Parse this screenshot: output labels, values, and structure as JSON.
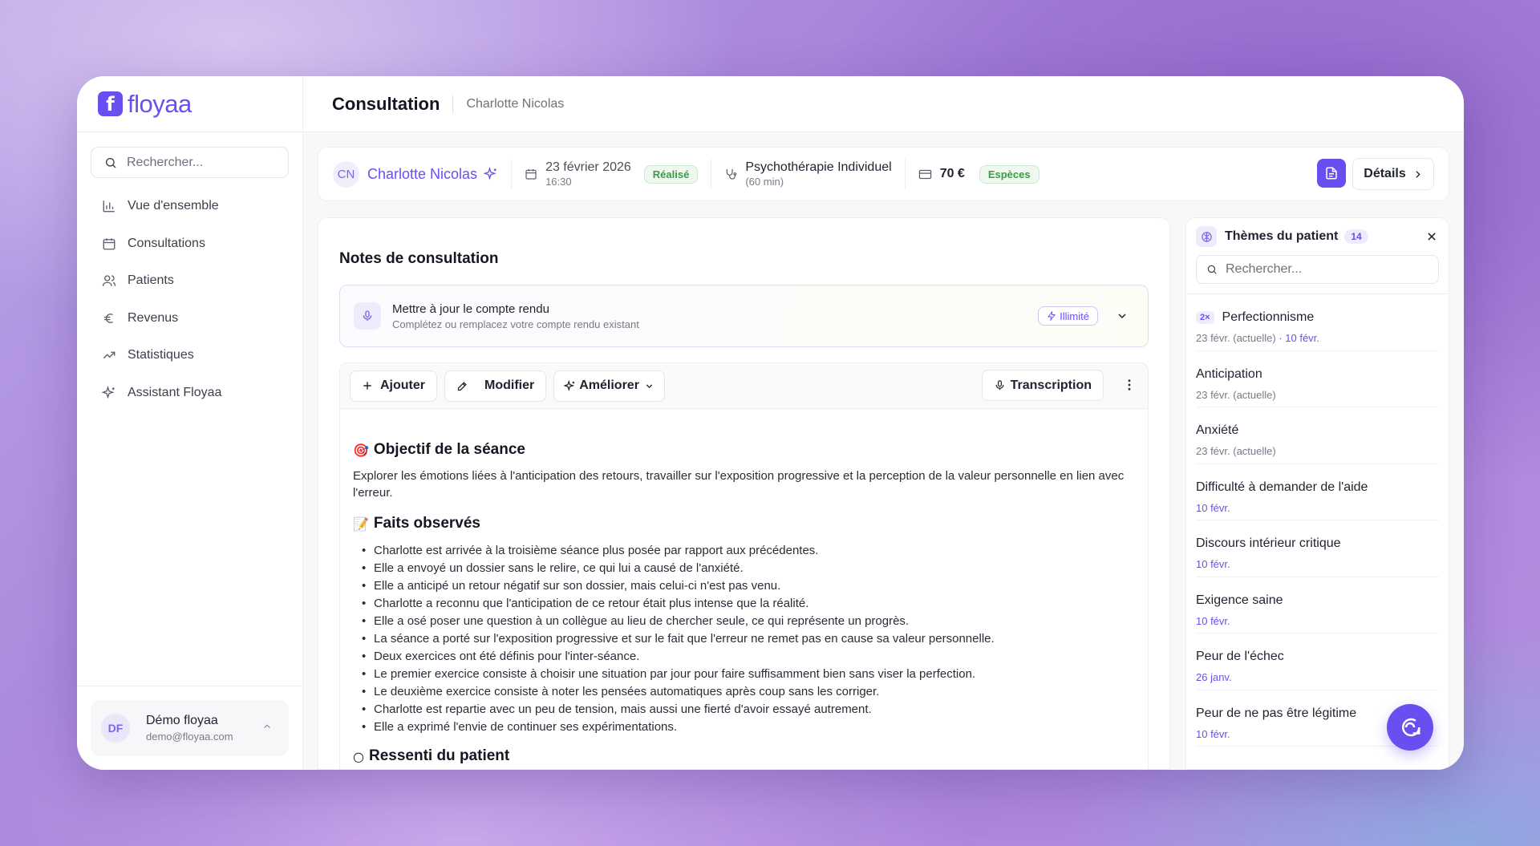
{
  "brand": {
    "logo_letter": "f",
    "name": "floyaa"
  },
  "sidebar": {
    "search_placeholder": "Rechercher...",
    "items": [
      {
        "label": "Vue d'ensemble",
        "icon": "bar-chart-icon"
      },
      {
        "label": "Consultations",
        "icon": "calendar-icon"
      },
      {
        "label": "Patients",
        "icon": "users-icon"
      },
      {
        "label": "Revenus",
        "icon": "euro-icon"
      },
      {
        "label": "Statistiques",
        "icon": "trending-up-icon"
      },
      {
        "label": "Assistant Floyaa",
        "icon": "sparkles-icon"
      }
    ],
    "user": {
      "initials": "DF",
      "name": "Démo floyaa",
      "email": "demo@floyaa.com"
    }
  },
  "header": {
    "title": "Consultation",
    "subtitle": "Charlotte Nicolas"
  },
  "consultation": {
    "patient_initials": "CN",
    "patient_name": "Charlotte Nicolas",
    "date": "23 février 2026",
    "time": "16:30",
    "status": "Réalisé",
    "type": "Psychothérapie Individuel",
    "duration": "(60 min)",
    "price": "70 €",
    "payment": "Espèces",
    "details_label": "Détails"
  },
  "notes": {
    "title": "Notes de consultation",
    "update": {
      "title": "Mettre à jour le compte rendu",
      "subtitle": "Complétez ou remplacez votre compte rendu existant",
      "badge": "Illimité"
    },
    "toolbar": {
      "add": "Ajouter",
      "edit": "Modifier",
      "improve": "Améliorer",
      "transcription": "Transcription"
    },
    "sections": {
      "objective_title": "Objectif de la séance",
      "objective_emoji": "🎯",
      "objective_text": "Explorer les émotions liées à l'anticipation des retours, travailler sur l'exposition progressive et la perception de la valeur personnelle en lien avec l'erreur.",
      "facts_title": "Faits observés",
      "facts_emoji": "📝",
      "facts": [
        "Charlotte est arrivée à la troisième séance plus posée par rapport aux précédentes.",
        "Elle a envoyé un dossier sans le relire, ce qui lui a causé de l'anxiété.",
        "Elle a anticipé un retour négatif sur son dossier, mais celui-ci n'est pas venu.",
        "Charlotte a reconnu que l'anticipation de ce retour était plus intense que la réalité.",
        "Elle a osé poser une question à un collègue au lieu de chercher seule, ce qui représente un progrès.",
        "La séance a porté sur l'exposition progressive et sur le fait que l'erreur ne remet pas en cause sa valeur personnelle.",
        "Deux exercices ont été définis pour l'inter-séance.",
        "Le premier exercice consiste à choisir une situation par jour pour faire suffisamment bien sans viser la perfection.",
        "Le deuxième exercice consiste à noter les pensées automatiques après coup sans les corriger.",
        "Charlotte est repartie avec un peu de tension, mais aussi une fierté d'avoir essayé autrement.",
        "Elle a exprimé l'envie de continuer ses expérimentations."
      ],
      "felt_title": "Ressenti du patient"
    }
  },
  "themes": {
    "title": "Thèmes du patient",
    "count": "14",
    "search_placeholder": "Rechercher...",
    "items": [
      {
        "badge": "2×",
        "name": "Perfectionnisme",
        "dates": "23 févr. (actuelle)",
        "extra": " · 10 févr."
      },
      {
        "name": "Anticipation",
        "dates": "23 févr. (actuelle)"
      },
      {
        "name": "Anxiété",
        "dates": "23 févr. (actuelle)"
      },
      {
        "name": "Difficulté à demander de l'aide",
        "dates_purple": "10 févr."
      },
      {
        "name": "Discours intérieur critique",
        "dates_purple": "10 févr."
      },
      {
        "name": "Exigence saine",
        "dates_purple": "10 févr."
      },
      {
        "name": "Peur de l'échec",
        "dates_purple": "26 janv."
      },
      {
        "name": "Peur de ne pas être légitime",
        "dates_purple": "10 févr."
      }
    ]
  },
  "colors": {
    "accent": "#6a4ff0",
    "success": "#3a9b48"
  }
}
